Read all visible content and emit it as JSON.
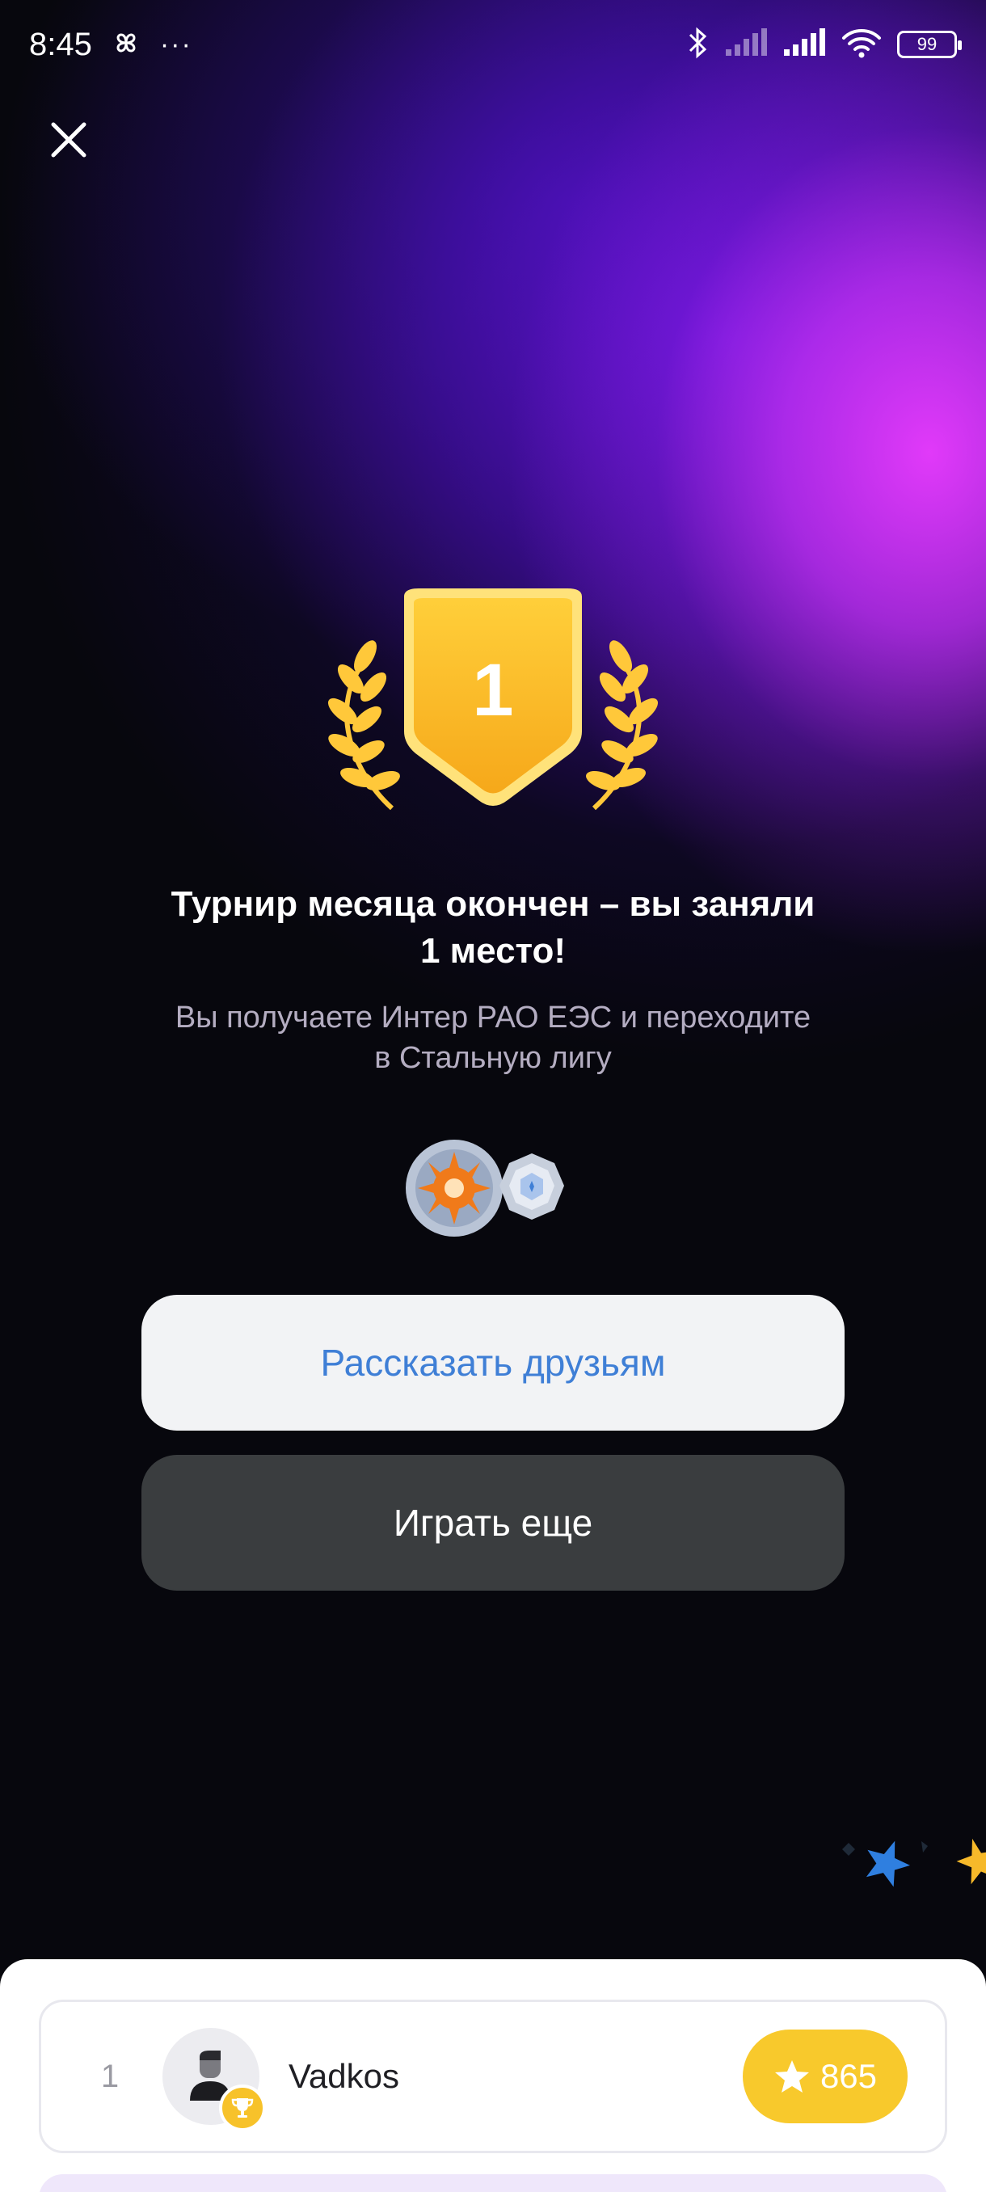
{
  "status_bar": {
    "time": "8:45",
    "more": "···",
    "battery": "99",
    "icons": [
      "pinwheel-icon",
      "bluetooth-icon",
      "signal-icon",
      "signal-icon",
      "wifi-icon",
      "battery-icon"
    ]
  },
  "icons": {
    "close": "close-icon",
    "trophy": "trophy-badge-icon",
    "star": "star-icon",
    "cup": "trophy-cup-icon"
  },
  "trophy": {
    "number": "1"
  },
  "result": {
    "title_line1": "Турнир месяца окончен – вы заняли",
    "title_line2": "1 место!",
    "subtitle_line1": "Вы получаете Интер РАО ЕЭС и переходите",
    "subtitle_line2": "в Стальную лигу"
  },
  "buttons": {
    "share": "Рассказать друзьям",
    "play": "Играть еще"
  },
  "leaderboard": {
    "rows": [
      {
        "rank": "1",
        "name": "Vadkos",
        "score": "865"
      }
    ]
  },
  "colors": {
    "accent_gold": "#f8c92c",
    "share_text": "#3f7fd6",
    "play_bg": "#3a3d3f",
    "magenta_glow": "#ea3cff"
  }
}
